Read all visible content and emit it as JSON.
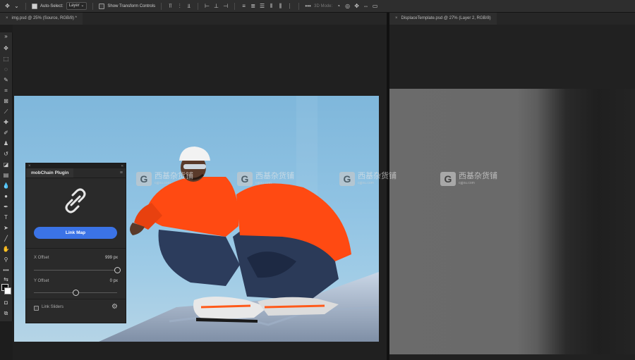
{
  "options_bar": {
    "auto_select_label": "Auto-Select:",
    "auto_select_value": "Layer",
    "show_transform_label": "Show Transform Controls",
    "mode_3d_label": "3D Mode:"
  },
  "tabs": {
    "left": "img.psd @ 25% (Source, RGB/8) *",
    "right": "DisplaceTemplate.psd @ 27% (Layer 2, RGB/8)"
  },
  "plugin": {
    "tab_title": "mobChain Plugin",
    "link_button": "Link Map",
    "x_offset_label": "X Offset",
    "x_offset_value": "999 px",
    "x_offset_fraction": 1.0,
    "y_offset_label": "Y Offset",
    "y_offset_value": "0 px",
    "y_offset_fraction": 0.5,
    "link_sliders_label": "Link Sliders",
    "link_sliders_checked": false
  },
  "watermark": {
    "cn": "西基杂货铺",
    "en": "cgjou.com"
  },
  "colors": {
    "accent_button": "#3b73e6",
    "jacket": "#ff4a12",
    "sky": "#8ec2e2"
  }
}
